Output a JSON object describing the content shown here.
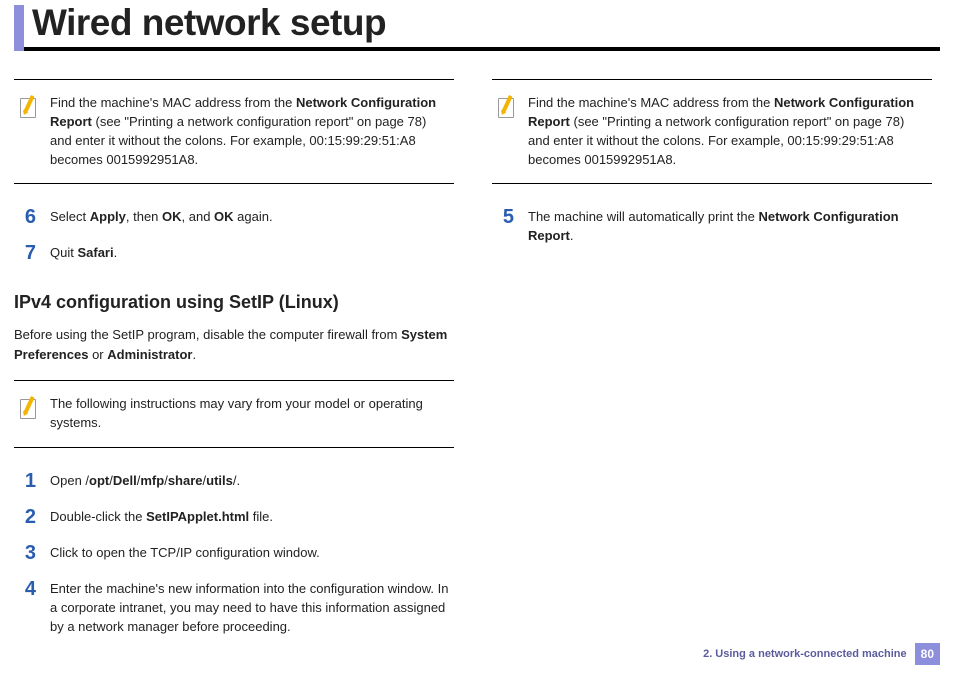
{
  "header": {
    "title": "Wired network setup"
  },
  "leftColumn": {
    "note1": {
      "pre": "Find the machine's MAC address from the ",
      "bold1": "Network Configuration Report",
      "post": " (see \"Printing a network configuration report\" on page 78) and enter it without the colons. For example, 00:15:99:29:51:A8 becomes 0015992951A8."
    },
    "step6": {
      "num": "6",
      "t1": "Select ",
      "b1": "Apply",
      "t2": ", then ",
      "b2": "OK",
      "t3": ", and ",
      "b3": "OK",
      "t4": " again."
    },
    "step7": {
      "num": "7",
      "t1": "Quit ",
      "b1": "Safari",
      "t2": "."
    },
    "heading": "IPv4 configuration using SetIP (Linux)",
    "intro": {
      "t1": "Before using the SetIP program, disable the computer firewall from ",
      "b1": "System Preferences",
      "t2": " or ",
      "b2": "Administrator",
      "t3": "."
    },
    "note2": {
      "text": "The following instructions may vary from your model or operating systems."
    },
    "lstep1": {
      "num": "1",
      "t1": "Open /",
      "b1": "opt",
      "t2": "/",
      "b2": "Dell",
      "t3": "/",
      "b3": "mfp",
      "t4": "/",
      "b4": "share",
      "t5": "/",
      "b5": "utils",
      "t6": "/."
    },
    "lstep2": {
      "num": "2",
      "t1": "Double-click the ",
      "b1": "SetIPApplet.html",
      "t2": " file."
    },
    "lstep3": {
      "num": "3",
      "text": "Click to open the TCP/IP configuration window."
    },
    "lstep4": {
      "num": "4",
      "text": "Enter the machine's new information into the configuration window. In a corporate intranet, you may need to have this information assigned by a network manager before proceeding."
    }
  },
  "rightColumn": {
    "note1": {
      "pre": "Find the machine's MAC address from the ",
      "bold1": "Network Configuration Report",
      "post": " (see \"Printing a network configuration report\" on page 78) and enter it without the colons. For example, 00:15:99:29:51:A8 becomes 0015992951A8."
    },
    "step5": {
      "num": "5",
      "t1": "The machine will automatically print the ",
      "b1": "Network Configuration Report",
      "t2": "."
    }
  },
  "footer": {
    "chapter": "2.  Using a network-connected machine",
    "page": "80"
  }
}
